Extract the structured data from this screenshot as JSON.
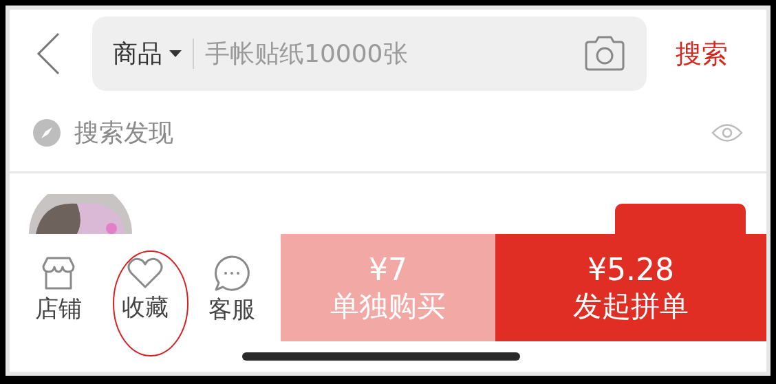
{
  "search_bar": {
    "scope": "商品",
    "placeholder": "手帐贴纸10000张",
    "search_button": "搜索"
  },
  "discover": {
    "title": "搜索发现"
  },
  "bottom_bar": {
    "actions": [
      {
        "label": "店铺",
        "kind": "store",
        "highlighted": false
      },
      {
        "label": "收藏",
        "kind": "favorite",
        "highlighted": true
      },
      {
        "label": "客服",
        "kind": "chat",
        "highlighted": false
      }
    ],
    "buy_alone": {
      "price": "¥7",
      "label": "单独购买"
    },
    "group_buy": {
      "price": "¥5.28",
      "label": "发起拼单"
    }
  }
}
